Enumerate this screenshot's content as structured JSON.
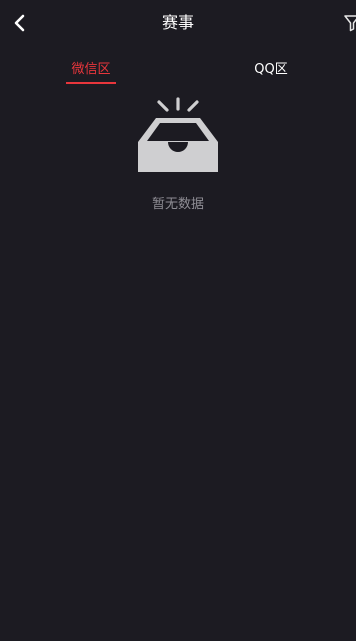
{
  "header": {
    "title": "赛事"
  },
  "tabs": [
    {
      "label": "微信区",
      "active": true
    },
    {
      "label": "QQ区",
      "active": false
    }
  ],
  "empty_state": {
    "text": "暂无数据",
    "icon": "empty-inbox-icon"
  },
  "colors": {
    "background": "#1c1b22",
    "accent": "#e8363c",
    "muted_text": "#8f8e95",
    "icon_gray": "#cfcfd1"
  }
}
